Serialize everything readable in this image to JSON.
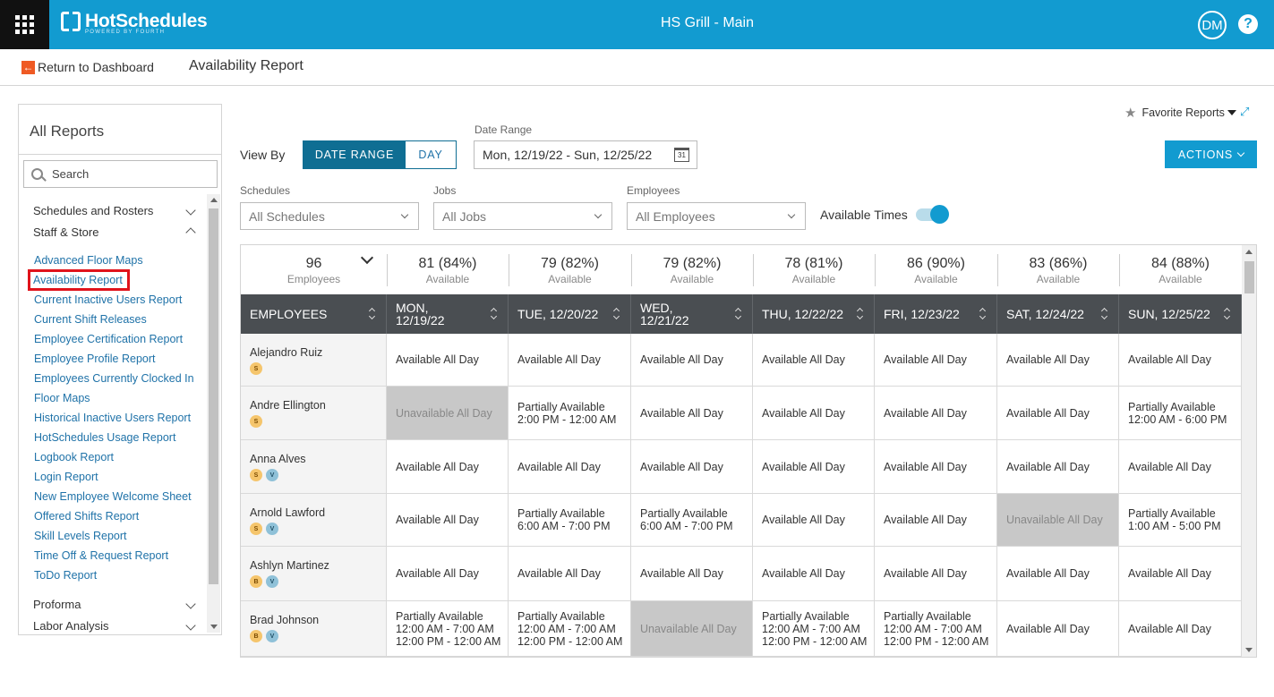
{
  "app": {
    "brand": "HotSchedules",
    "brand_sub": "POWERED BY FOURTH",
    "location_title": "HS Grill - Main",
    "user_initials": "DM",
    "help_symbol": "?"
  },
  "subheader": {
    "back_label": "Return to Dashboard",
    "page_title": "Availability Report"
  },
  "sidebar": {
    "title": "All Reports",
    "search_placeholder": "Search",
    "sections": [
      {
        "label": "Schedules and Rosters",
        "state": "collapsed"
      },
      {
        "label": "Staff & Store",
        "state": "expanded"
      },
      {
        "label": "Proforma",
        "state": "collapsed"
      },
      {
        "label": "Labor Analysis",
        "state": "collapsed"
      }
    ],
    "links": [
      "Advanced Floor Maps",
      "Availability Report",
      "Current Inactive Users Report",
      "Current Shift Releases",
      "Employee Certification Report",
      "Employee Profile Report",
      "Employees Currently Clocked In",
      "Floor Maps",
      "Historical Inactive Users Report",
      "HotSchedules Usage Report",
      "Logbook Report",
      "Login Report",
      "New Employee Welcome Sheet",
      "Offered Shifts Report",
      "Skill Levels Report",
      "Time Off & Request Report",
      "ToDo Report"
    ],
    "active_link": "Availability Report"
  },
  "controls": {
    "favorite_reports": "Favorite Reports",
    "view_by_label": "View By",
    "view_by_options": [
      "DATE RANGE",
      "DAY"
    ],
    "view_by_selected": "DATE RANGE",
    "date_range_label": "Date Range",
    "date_range_value": "Mon, 12/19/22 - Sun, 12/25/22",
    "calendar_icon_text": "31",
    "actions_label": "ACTIONS",
    "filters": [
      {
        "label": "Schedules",
        "value": "All Schedules"
      },
      {
        "label": "Jobs",
        "value": "All Jobs"
      },
      {
        "label": "Employees",
        "value": "All Employees"
      }
    ],
    "available_times_label": "Available Times",
    "available_times_on": true
  },
  "summary": {
    "employees": {
      "count": "96",
      "label": "Employees"
    },
    "days": [
      {
        "value": "81 (84%)",
        "label": "Available"
      },
      {
        "value": "79 (82%)",
        "label": "Available"
      },
      {
        "value": "79 (82%)",
        "label": "Available"
      },
      {
        "value": "78 (81%)",
        "label": "Available"
      },
      {
        "value": "86 (90%)",
        "label": "Available"
      },
      {
        "value": "83 (86%)",
        "label": "Available"
      },
      {
        "value": "84 (88%)",
        "label": "Available"
      }
    ]
  },
  "table": {
    "columns": [
      "EMPLOYEES",
      "MON, 12/19/22",
      "TUE, 12/20/22",
      "WED, 12/21/22",
      "THU, 12/22/22",
      "FRI, 12/23/22",
      "SAT, 12/24/22",
      "SUN, 12/25/22"
    ],
    "rows": [
      {
        "name": "Alejandro Ruiz",
        "badges": [
          "S"
        ],
        "cells": [
          {
            "status": "available",
            "lines": [
              "Available All Day"
            ]
          },
          {
            "status": "available",
            "lines": [
              "Available All Day"
            ]
          },
          {
            "status": "available",
            "lines": [
              "Available All Day"
            ]
          },
          {
            "status": "available",
            "lines": [
              "Available All Day"
            ]
          },
          {
            "status": "available",
            "lines": [
              "Available All Day"
            ]
          },
          {
            "status": "available",
            "lines": [
              "Available All Day"
            ]
          },
          {
            "status": "available",
            "lines": [
              "Available All Day"
            ]
          }
        ]
      },
      {
        "name": "Andre Ellington",
        "badges": [
          "S"
        ],
        "cells": [
          {
            "status": "unavailable",
            "lines": [
              "Unavailable All Day"
            ]
          },
          {
            "status": "partial",
            "lines": [
              "Partially Available",
              "2:00 PM - 12:00 AM"
            ]
          },
          {
            "status": "available",
            "lines": [
              "Available All Day"
            ]
          },
          {
            "status": "available",
            "lines": [
              "Available All Day"
            ]
          },
          {
            "status": "available",
            "lines": [
              "Available All Day"
            ]
          },
          {
            "status": "available",
            "lines": [
              "Available All Day"
            ]
          },
          {
            "status": "partial",
            "lines": [
              "Partially Available",
              "12:00 AM - 6:00 PM"
            ]
          }
        ]
      },
      {
        "name": "Anna Alves",
        "badges": [
          "S",
          "V"
        ],
        "cells": [
          {
            "status": "available",
            "lines": [
              "Available All Day"
            ]
          },
          {
            "status": "available",
            "lines": [
              "Available All Day"
            ]
          },
          {
            "status": "available",
            "lines": [
              "Available All Day"
            ]
          },
          {
            "status": "available",
            "lines": [
              "Available All Day"
            ]
          },
          {
            "status": "available",
            "lines": [
              "Available All Day"
            ]
          },
          {
            "status": "available",
            "lines": [
              "Available All Day"
            ]
          },
          {
            "status": "available",
            "lines": [
              "Available All Day"
            ]
          }
        ]
      },
      {
        "name": "Arnold Lawford",
        "badges": [
          "S",
          "V"
        ],
        "cells": [
          {
            "status": "available",
            "lines": [
              "Available All Day"
            ]
          },
          {
            "status": "partial",
            "lines": [
              "Partially Available",
              "6:00 AM - 7:00 PM"
            ]
          },
          {
            "status": "partial",
            "lines": [
              "Partially Available",
              "6:00 AM - 7:00 PM"
            ]
          },
          {
            "status": "available",
            "lines": [
              "Available All Day"
            ]
          },
          {
            "status": "available",
            "lines": [
              "Available All Day"
            ]
          },
          {
            "status": "unavailable",
            "lines": [
              "Unavailable All Day"
            ]
          },
          {
            "status": "partial",
            "lines": [
              "Partially Available",
              "1:00 AM - 5:00 PM"
            ]
          }
        ]
      },
      {
        "name": "Ashlyn Martinez",
        "badges": [
          "B",
          "V"
        ],
        "cells": [
          {
            "status": "available",
            "lines": [
              "Available All Day"
            ]
          },
          {
            "status": "available",
            "lines": [
              "Available All Day"
            ]
          },
          {
            "status": "available",
            "lines": [
              "Available All Day"
            ]
          },
          {
            "status": "available",
            "lines": [
              "Available All Day"
            ]
          },
          {
            "status": "available",
            "lines": [
              "Available All Day"
            ]
          },
          {
            "status": "available",
            "lines": [
              "Available All Day"
            ]
          },
          {
            "status": "available",
            "lines": [
              "Available All Day"
            ]
          }
        ]
      },
      {
        "name": "Brad Johnson",
        "badges": [
          "B",
          "V"
        ],
        "cells": [
          {
            "status": "partial",
            "lines": [
              "Partially Available",
              "12:00 AM - 7:00 AM",
              "12:00 PM - 12:00 AM"
            ]
          },
          {
            "status": "partial",
            "lines": [
              "Partially Available",
              "12:00 AM - 7:00 AM",
              "12:00 PM - 12:00 AM"
            ]
          },
          {
            "status": "unavailable",
            "lines": [
              "Unavailable All Day"
            ]
          },
          {
            "status": "partial",
            "lines": [
              "Partially Available",
              "12:00 AM - 7:00 AM",
              "12:00 PM - 12:00 AM"
            ]
          },
          {
            "status": "partial",
            "lines": [
              "Partially Available",
              "12:00 AM - 7:00 AM",
              "12:00 PM - 12:00 AM"
            ]
          },
          {
            "status": "available",
            "lines": [
              "Available All Day"
            ]
          },
          {
            "status": "available",
            "lines": [
              "Available All Day"
            ]
          }
        ]
      }
    ]
  },
  "colors": {
    "brand_blue": "#129bd0",
    "dark_teal": "#0f6e93",
    "header_gray": "#4a4e52",
    "unavailable_gray": "#c8c8c8",
    "link_blue": "#1f72a8",
    "active_outline": "#e0131b"
  },
  "icons": {
    "app_launcher": "grid-icon",
    "back": "arrow-left-icon",
    "search": "search-icon",
    "favorite": "star-icon",
    "expand": "expand-icon",
    "calendar": "calendar-icon",
    "help": "help-icon"
  }
}
